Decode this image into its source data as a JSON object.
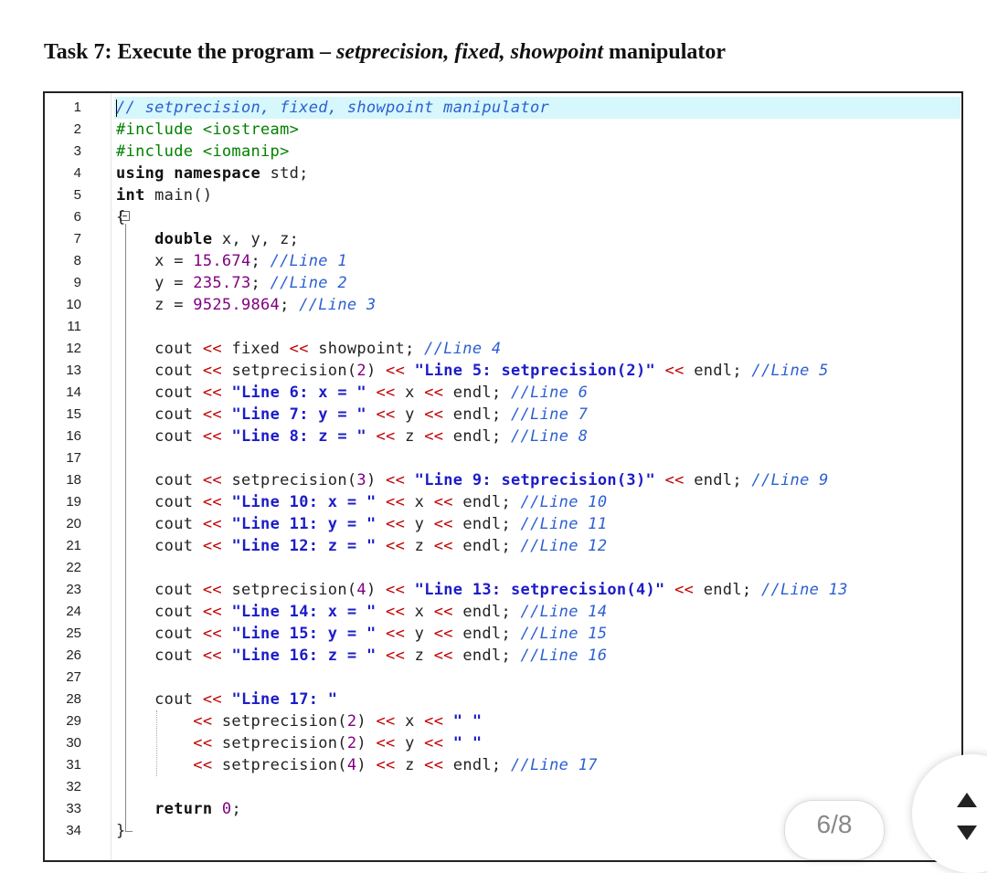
{
  "title": {
    "prefix": "Task 7: Execute the program – ",
    "italic": "setprecision, fixed, showpoint",
    "suffix": " manipulator"
  },
  "page_indicator": "6/8",
  "code_lines": [
    {
      "n": "1",
      "parts": [
        [
          "cm",
          "// setprecision, fixed, showpoint manipulator"
        ]
      ]
    },
    {
      "n": "2",
      "parts": [
        [
          "pp",
          "#include <iostream>"
        ]
      ]
    },
    {
      "n": "3",
      "parts": [
        [
          "pp",
          "#include <iomanip>"
        ]
      ]
    },
    {
      "n": "4",
      "parts": [
        [
          "kw",
          "using namespace"
        ],
        [
          "",
          " std;"
        ]
      ]
    },
    {
      "n": "5",
      "parts": [
        [
          "kw",
          "int"
        ],
        [
          "",
          " main()"
        ]
      ]
    },
    {
      "n": "6",
      "parts": [
        [
          "",
          "{"
        ]
      ]
    },
    {
      "n": "7",
      "parts": [
        [
          "",
          "    "
        ],
        [
          "kw",
          "double"
        ],
        [
          "",
          " x, y, z;"
        ]
      ]
    },
    {
      "n": "8",
      "parts": [
        [
          "",
          "    x = "
        ],
        [
          "num",
          "15.674"
        ],
        [
          "",
          "; "
        ],
        [
          "cm",
          "//Line 1"
        ]
      ]
    },
    {
      "n": "9",
      "parts": [
        [
          "",
          "    y = "
        ],
        [
          "num",
          "235.73"
        ],
        [
          "",
          "; "
        ],
        [
          "cm",
          "//Line 2"
        ]
      ]
    },
    {
      "n": "10",
      "parts": [
        [
          "",
          "    z = "
        ],
        [
          "num",
          "9525.9864"
        ],
        [
          "",
          "; "
        ],
        [
          "cm",
          "//Line 3"
        ]
      ]
    },
    {
      "n": "11",
      "parts": []
    },
    {
      "n": "12",
      "parts": [
        [
          "",
          "    cout "
        ],
        [
          "op",
          "<<"
        ],
        [
          "",
          " fixed "
        ],
        [
          "op",
          "<<"
        ],
        [
          "",
          " showpoint; "
        ],
        [
          "cm",
          "//Line 4"
        ]
      ]
    },
    {
      "n": "13",
      "parts": [
        [
          "",
          "    cout "
        ],
        [
          "op",
          "<<"
        ],
        [
          "",
          " setprecision("
        ],
        [
          "num",
          "2"
        ],
        [
          "",
          ") "
        ],
        [
          "op",
          "<<"
        ],
        [
          "",
          " "
        ],
        [
          "str",
          "\"Line 5: setprecision(2)\""
        ],
        [
          "",
          " "
        ],
        [
          "op",
          "<<"
        ],
        [
          "",
          " endl; "
        ],
        [
          "cm",
          "//Line 5"
        ]
      ]
    },
    {
      "n": "14",
      "parts": [
        [
          "",
          "    cout "
        ],
        [
          "op",
          "<<"
        ],
        [
          "",
          " "
        ],
        [
          "str",
          "\"Line 6: x = \""
        ],
        [
          "",
          " "
        ],
        [
          "op",
          "<<"
        ],
        [
          "",
          " x "
        ],
        [
          "op",
          "<<"
        ],
        [
          "",
          " endl; "
        ],
        [
          "cm",
          "//Line 6"
        ]
      ]
    },
    {
      "n": "15",
      "parts": [
        [
          "",
          "    cout "
        ],
        [
          "op",
          "<<"
        ],
        [
          "",
          " "
        ],
        [
          "str",
          "\"Line 7: y = \""
        ],
        [
          "",
          " "
        ],
        [
          "op",
          "<<"
        ],
        [
          "",
          " y "
        ],
        [
          "op",
          "<<"
        ],
        [
          "",
          " endl; "
        ],
        [
          "cm",
          "//Line 7"
        ]
      ]
    },
    {
      "n": "16",
      "parts": [
        [
          "",
          "    cout "
        ],
        [
          "op",
          "<<"
        ],
        [
          "",
          " "
        ],
        [
          "str",
          "\"Line 8: z = \""
        ],
        [
          "",
          " "
        ],
        [
          "op",
          "<<"
        ],
        [
          "",
          " z "
        ],
        [
          "op",
          "<<"
        ],
        [
          "",
          " endl; "
        ],
        [
          "cm",
          "//Line 8"
        ]
      ]
    },
    {
      "n": "17",
      "parts": []
    },
    {
      "n": "18",
      "parts": [
        [
          "",
          "    cout "
        ],
        [
          "op",
          "<<"
        ],
        [
          "",
          " setprecision("
        ],
        [
          "num",
          "3"
        ],
        [
          "",
          ") "
        ],
        [
          "op",
          "<<"
        ],
        [
          "",
          " "
        ],
        [
          "str",
          "\"Line 9: setprecision(3)\""
        ],
        [
          "",
          " "
        ],
        [
          "op",
          "<<"
        ],
        [
          "",
          " endl; "
        ],
        [
          "cm",
          "//Line 9"
        ]
      ]
    },
    {
      "n": "19",
      "parts": [
        [
          "",
          "    cout "
        ],
        [
          "op",
          "<<"
        ],
        [
          "",
          " "
        ],
        [
          "str",
          "\"Line 10: x = \""
        ],
        [
          "",
          " "
        ],
        [
          "op",
          "<<"
        ],
        [
          "",
          " x "
        ],
        [
          "op",
          "<<"
        ],
        [
          "",
          " endl; "
        ],
        [
          "cm",
          "//Line 10"
        ]
      ]
    },
    {
      "n": "20",
      "parts": [
        [
          "",
          "    cout "
        ],
        [
          "op",
          "<<"
        ],
        [
          "",
          " "
        ],
        [
          "str",
          "\"Line 11: y = \""
        ],
        [
          "",
          " "
        ],
        [
          "op",
          "<<"
        ],
        [
          "",
          " y "
        ],
        [
          "op",
          "<<"
        ],
        [
          "",
          " endl; "
        ],
        [
          "cm",
          "//Line 11"
        ]
      ]
    },
    {
      "n": "21",
      "parts": [
        [
          "",
          "    cout "
        ],
        [
          "op",
          "<<"
        ],
        [
          "",
          " "
        ],
        [
          "str",
          "\"Line 12: z = \""
        ],
        [
          "",
          " "
        ],
        [
          "op",
          "<<"
        ],
        [
          "",
          " z "
        ],
        [
          "op",
          "<<"
        ],
        [
          "",
          " endl; "
        ],
        [
          "cm",
          "//Line 12"
        ]
      ]
    },
    {
      "n": "22",
      "parts": []
    },
    {
      "n": "23",
      "parts": [
        [
          "",
          "    cout "
        ],
        [
          "op",
          "<<"
        ],
        [
          "",
          " setprecision("
        ],
        [
          "num",
          "4"
        ],
        [
          "",
          ") "
        ],
        [
          "op",
          "<<"
        ],
        [
          "",
          " "
        ],
        [
          "str",
          "\"Line 13: setprecision(4)\""
        ],
        [
          "",
          " "
        ],
        [
          "op",
          "<<"
        ],
        [
          "",
          " endl; "
        ],
        [
          "cm",
          "//Line 13"
        ]
      ]
    },
    {
      "n": "24",
      "parts": [
        [
          "",
          "    cout "
        ],
        [
          "op",
          "<<"
        ],
        [
          "",
          " "
        ],
        [
          "str",
          "\"Line 14: x = \""
        ],
        [
          "",
          " "
        ],
        [
          "op",
          "<<"
        ],
        [
          "",
          " x "
        ],
        [
          "op",
          "<<"
        ],
        [
          "",
          " endl; "
        ],
        [
          "cm",
          "//Line 14"
        ]
      ]
    },
    {
      "n": "25",
      "parts": [
        [
          "",
          "    cout "
        ],
        [
          "op",
          "<<"
        ],
        [
          "",
          " "
        ],
        [
          "str",
          "\"Line 15: y = \""
        ],
        [
          "",
          " "
        ],
        [
          "op",
          "<<"
        ],
        [
          "",
          " y "
        ],
        [
          "op",
          "<<"
        ],
        [
          "",
          " endl; "
        ],
        [
          "cm",
          "//Line 15"
        ]
      ]
    },
    {
      "n": "26",
      "parts": [
        [
          "",
          "    cout "
        ],
        [
          "op",
          "<<"
        ],
        [
          "",
          " "
        ],
        [
          "str",
          "\"Line 16: z = \""
        ],
        [
          "",
          " "
        ],
        [
          "op",
          "<<"
        ],
        [
          "",
          " z "
        ],
        [
          "op",
          "<<"
        ],
        [
          "",
          " endl; "
        ],
        [
          "cm",
          "//Line 16"
        ]
      ]
    },
    {
      "n": "27",
      "parts": []
    },
    {
      "n": "28",
      "parts": [
        [
          "",
          "    cout "
        ],
        [
          "op",
          "<<"
        ],
        [
          "",
          " "
        ],
        [
          "str",
          "\"Line 17: \""
        ]
      ]
    },
    {
      "n": "29",
      "parts": [
        [
          "",
          "        "
        ],
        [
          "op",
          "<<"
        ],
        [
          "",
          " setprecision("
        ],
        [
          "num",
          "2"
        ],
        [
          "",
          ") "
        ],
        [
          "op",
          "<<"
        ],
        [
          "",
          " x "
        ],
        [
          "op",
          "<<"
        ],
        [
          "",
          " "
        ],
        [
          "str",
          "\" \""
        ]
      ]
    },
    {
      "n": "30",
      "parts": [
        [
          "",
          "        "
        ],
        [
          "op",
          "<<"
        ],
        [
          "",
          " setprecision("
        ],
        [
          "num",
          "2"
        ],
        [
          "",
          ") "
        ],
        [
          "op",
          "<<"
        ],
        [
          "",
          " y "
        ],
        [
          "op",
          "<<"
        ],
        [
          "",
          " "
        ],
        [
          "str",
          "\" \""
        ]
      ]
    },
    {
      "n": "31",
      "parts": [
        [
          "",
          "        "
        ],
        [
          "op",
          "<<"
        ],
        [
          "",
          " setprecision("
        ],
        [
          "num",
          "4"
        ],
        [
          "",
          ") "
        ],
        [
          "op",
          "<<"
        ],
        [
          "",
          " z "
        ],
        [
          "op",
          "<<"
        ],
        [
          "",
          " endl; "
        ],
        [
          "cm",
          "//Line 17"
        ]
      ]
    },
    {
      "n": "32",
      "parts": []
    },
    {
      "n": "33",
      "parts": [
        [
          "",
          "    "
        ],
        [
          "kw",
          "return"
        ],
        [
          "",
          " "
        ],
        [
          "num",
          "0"
        ],
        [
          "",
          ";"
        ]
      ]
    },
    {
      "n": "34",
      "parts": [
        [
          "",
          "}"
        ]
      ]
    }
  ]
}
